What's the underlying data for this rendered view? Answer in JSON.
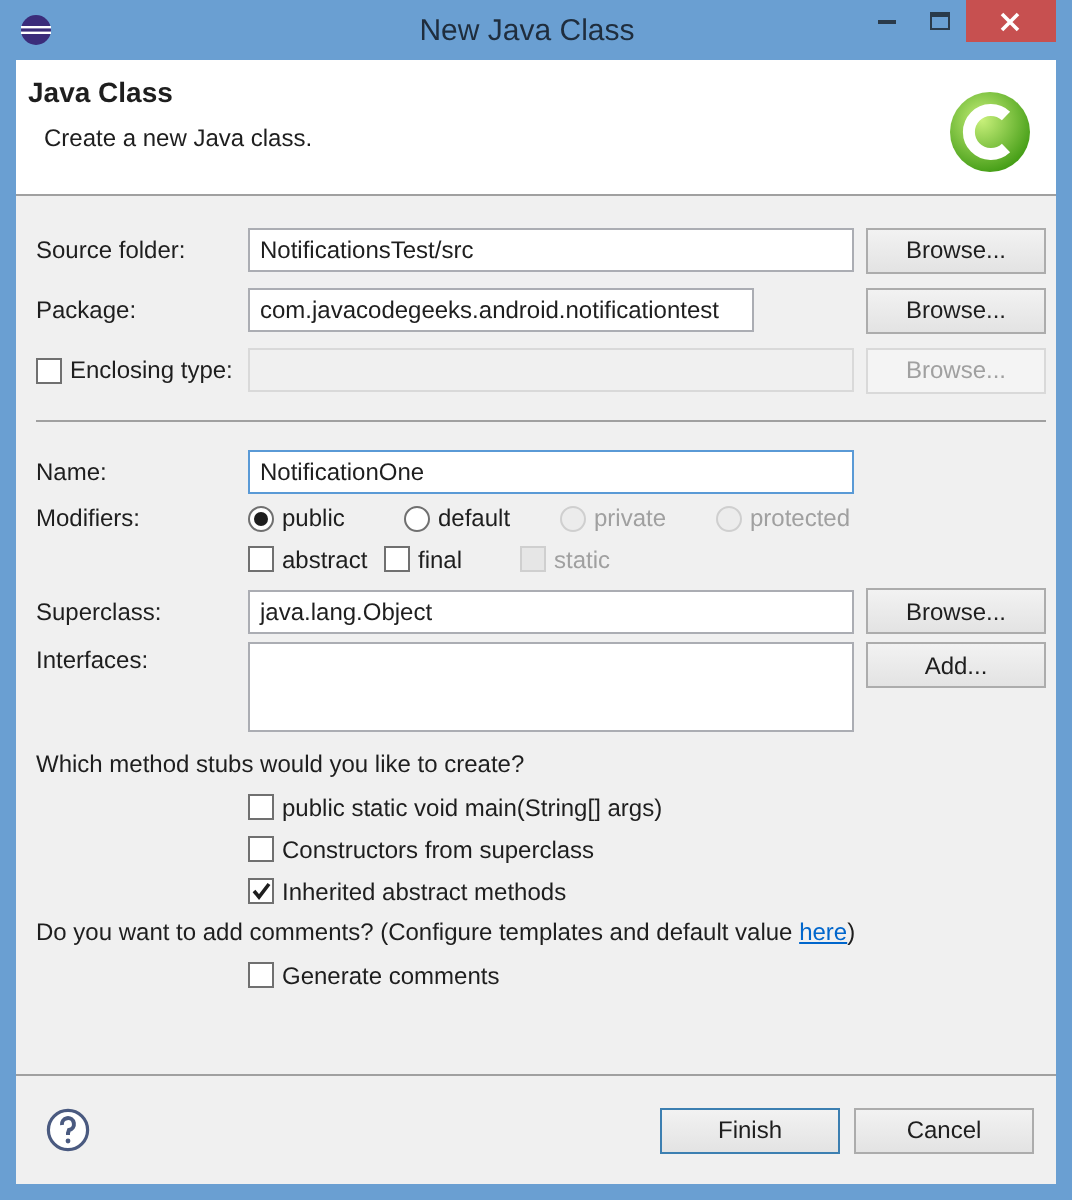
{
  "window": {
    "title": "New Java Class"
  },
  "header": {
    "title": "Java Class",
    "description": "Create a new Java class."
  },
  "location_rows": [
    {
      "kind": "text",
      "label": "Source folder:",
      "value": "NotificationsTest/src",
      "narrow": false,
      "button": "Browse...",
      "disabled": false
    },
    {
      "kind": "text",
      "label": "Package:",
      "value": "com.javacodegeeks.android.notificationtest",
      "narrow": true,
      "button": "Browse...",
      "disabled": false
    },
    {
      "kind": "checkbox",
      "label": "Enclosing type:",
      "checked": false,
      "narrow": false,
      "button": "Browse...",
      "disabled": true
    }
  ],
  "name_row": {
    "label": "Name:",
    "value": "NotificationOne",
    "focused": true
  },
  "modifiers": {
    "label": "Modifiers:",
    "radios": [
      {
        "label": "public",
        "selected": true,
        "disabled": false
      },
      {
        "label": "default",
        "selected": false,
        "disabled": false
      },
      {
        "label": "private",
        "selected": false,
        "disabled": true
      },
      {
        "label": "protected",
        "selected": false,
        "disabled": true
      }
    ],
    "checkboxes": [
      {
        "label": "abstract",
        "checked": false,
        "disabled": false
      },
      {
        "label": "final",
        "checked": false,
        "disabled": false
      },
      {
        "label": "static",
        "checked": false,
        "disabled": true
      }
    ]
  },
  "superclass": {
    "label": "Superclass:",
    "value": "java.lang.Object",
    "button": "Browse..."
  },
  "interfaces": {
    "label": "Interfaces:",
    "button": "Add..."
  },
  "stubs": {
    "question": "Which method stubs would you like to create?",
    "options": [
      {
        "label": "public static void main(String[] args)",
        "checked": false
      },
      {
        "label": "Constructors from superclass",
        "checked": false
      },
      {
        "label": "Inherited abstract methods",
        "checked": true
      }
    ]
  },
  "comments": {
    "text_before": "Do you want to add comments? (Configure templates and default value ",
    "link": "here",
    "text_after": ")",
    "option": {
      "label": "Generate comments",
      "checked": false
    }
  },
  "footer": {
    "buttons": [
      {
        "label": "Finish",
        "default": true
      },
      {
        "label": "Cancel",
        "default": false
      }
    ]
  }
}
